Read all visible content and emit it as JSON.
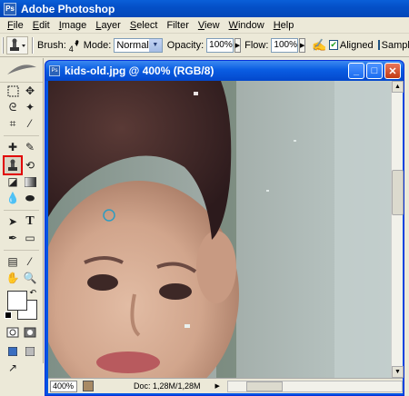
{
  "app": {
    "title": "Adobe Photoshop",
    "logo": "Ps"
  },
  "menu": [
    {
      "u": "F",
      "rest": "ile"
    },
    {
      "u": "E",
      "rest": "dit"
    },
    {
      "u": "I",
      "rest": "mage"
    },
    {
      "u": "L",
      "rest": "ayer"
    },
    {
      "u": "S",
      "rest": "elect"
    },
    {
      "u": "",
      "rest": "Filter"
    },
    {
      "u": "V",
      "rest": "iew"
    },
    {
      "u": "W",
      "rest": "indow"
    },
    {
      "u": "H",
      "rest": "elp"
    }
  ],
  "options": {
    "brush_label": "Brush:",
    "brush_size": "4",
    "mode_label": "Mode:",
    "mode_value": "Normal",
    "opacity_label": "Opacity:",
    "opacity_value": "100%",
    "flow_label": "Flow:",
    "flow_value": "100%",
    "aligned_label": "Aligned",
    "aligned_checked": true,
    "sample_label": "Sample",
    "sample_checked": false
  },
  "toolbox": {
    "selected_tool": "clone-stamp",
    "foreground": "#ffffff",
    "background": "#ffffff"
  },
  "document": {
    "title": "kids-old.jpg @ 400% (RGB/8)",
    "zoom": "400%",
    "doc_info": "Doc: 1,28M/1,28M"
  }
}
